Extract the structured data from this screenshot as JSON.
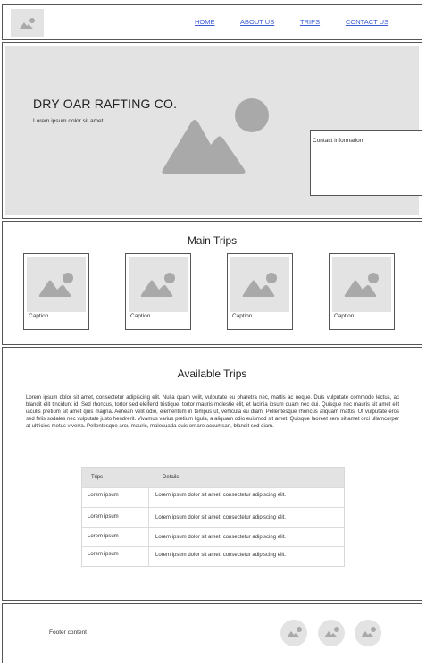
{
  "nav": {
    "items": [
      "HOME",
      "ABOUT US",
      "TRIPS",
      "CONTACT US"
    ]
  },
  "hero": {
    "title": "DRY OAR RAFTING CO.",
    "subtitle": "Lorem ipsum dolor sit amet.",
    "contact_label": "Contact information"
  },
  "main_trips": {
    "title": "Main Trips",
    "captions": [
      "Caption",
      "Caption",
      "Caption",
      "Caption"
    ]
  },
  "available": {
    "title": "Available Trips",
    "paragraph": "Lorem ipsum dolor sit amet, consectetur adipiscing elit. Nulla quam velit, vulputate eu pharetra nec, mattis ac neque. Duis vulputate commodo lectus, ac blandit elit tincidunt id. Sed rhoncus, tortor sed eleifend tristique, tortor mauris molestie elit, et lacinia ipsum quam nec dui. Quisque nec mauris sit amet elit iaculis pretium sit amet quis magna. Aenean velit odio, elementum in tempus ut, vehicula eu diam. Pellentesque rhoncus aliquam mattis. Ut vulputate eros sed felis sodales nec vulputate justo hendrerit. Vivamus varius pretium ligula, a aliquam odio euismod sit amet. Quisque laoreet sem sit amet orci ullamcorper at ultricies metus viverra. Pellentesque arcu mauris, malesuada quis ornare accumsan, blandit sed diam.",
    "table": {
      "headers": [
        "Trips",
        "Details"
      ],
      "rows": [
        [
          "Lorem ipsum",
          "Lorem ipsum dolor sit amet, consectetur adipiscing elit."
        ],
        [
          "Lorem ipsum",
          "Lorem ipsum dolor sit amet, consectetur adipiscing elit."
        ],
        [
          "Lorem ipsum",
          "Lorem ipsum dolor sit amet, consectetur adipiscing elit."
        ],
        [
          "Lorem ipsum",
          "Lorem ipsum dolor sit amet, consectetur adipiscing elit."
        ]
      ]
    }
  },
  "footer": {
    "text": "Footer content",
    "icons": [
      "image-placeholder-icon",
      "image-placeholder-icon",
      "image-placeholder-icon"
    ]
  },
  "colors": {
    "placeholder_bg": "#e3e3e3",
    "placeholder_icon": "#a9a9a9",
    "link": "#3a5bd0",
    "border": "#555555"
  }
}
